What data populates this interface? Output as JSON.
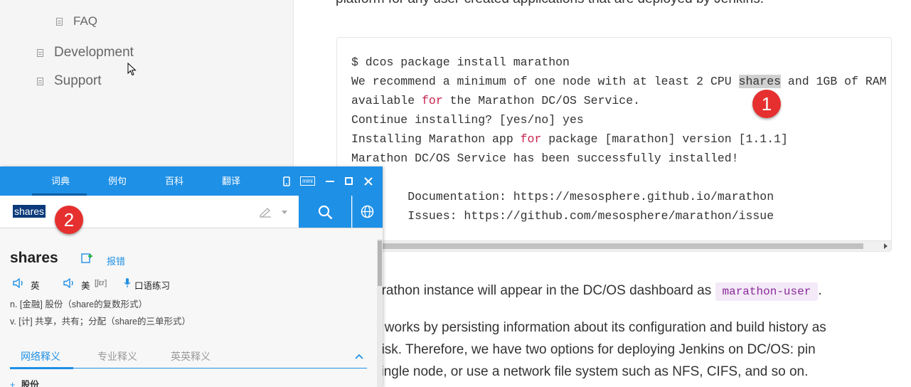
{
  "sidebar": {
    "items": [
      {
        "label": "FAQ"
      },
      {
        "label": "Development"
      },
      {
        "label": "Support"
      }
    ]
  },
  "main": {
    "top_text": "platform for any user-created applications that are deployed by Jenkins.",
    "code": {
      "l1": "$ dcos package install marathon",
      "l2a": "We recommend a minimum of one node with at least 2 CPU ",
      "l2_highlight": "shares",
      "l2b": " and 1GB of RAM",
      "l3a": "available ",
      "l3_kw": "for",
      "l3b": " the Marathon DC/OS Service.",
      "l4": "Continue installing? [yes/no] yes",
      "l5a": "Installing Marathon app ",
      "l5_kw": "for",
      "l5b": " package [marathon] version [1.1.1]",
      "l6": "Marathon DC/OS Service has been successfully installed!",
      "l7": "",
      "l8": "\tDocumentation: https://mesosphere.github.io/marathon",
      "l9": "\tIssues: https://github.com/mesosphere/marathon/issue"
    },
    "para1_text": "arathon instance will appear in the DC/OS dashboard as ",
    "para1_code": "marathon-user",
    "para1_end": ".",
    "para2_line1": "s works by persisting information about its configuration and build history as",
    "para2_line2": " disk. Therefore, we have two options for deploying Jenkins on DC/OS: pin",
    "para2_line3": "single node, or use a network file system such as NFS, CIFS, and so on."
  },
  "badges": {
    "one": "1",
    "two": "2"
  },
  "dict": {
    "tabs": [
      "词典",
      "例句",
      "百科",
      "翻译"
    ],
    "active_tab": "词典",
    "mini_label": "mini",
    "query": "shares",
    "word": "shares",
    "report_label": "报错",
    "pron_uk": "英",
    "pron_us": "美",
    "phonetic_us": "[ʃɛr]",
    "speaking_label": "口语练习",
    "def1": "n. [金融] 股份（share的复数形式）",
    "def2": "v. [计] 共享，共有；分配（share的三单形式）",
    "subtabs": [
      "网络释义",
      "专业释义",
      "英英释义"
    ],
    "first_entry": "股份"
  },
  "colors": {
    "accent": "#1e90e6",
    "badge": "#e5302f",
    "keyword": "#c7254e"
  }
}
